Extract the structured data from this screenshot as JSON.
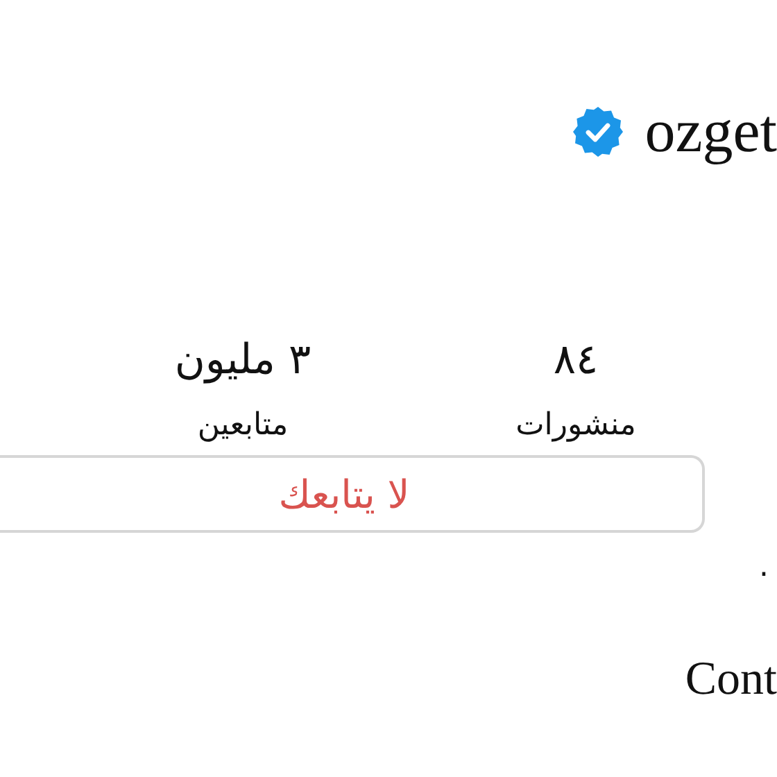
{
  "profile": {
    "username": "ozget",
    "verified": true
  },
  "stats": [
    {
      "value": "٨٤",
      "label": "منشورات"
    },
    {
      "value": "٣ مليون",
      "label": "متابعين"
    }
  ],
  "follow_status": {
    "label": "لا يتابعك"
  },
  "bio": {
    "text": "."
  },
  "contact": {
    "label": "Cont"
  }
}
